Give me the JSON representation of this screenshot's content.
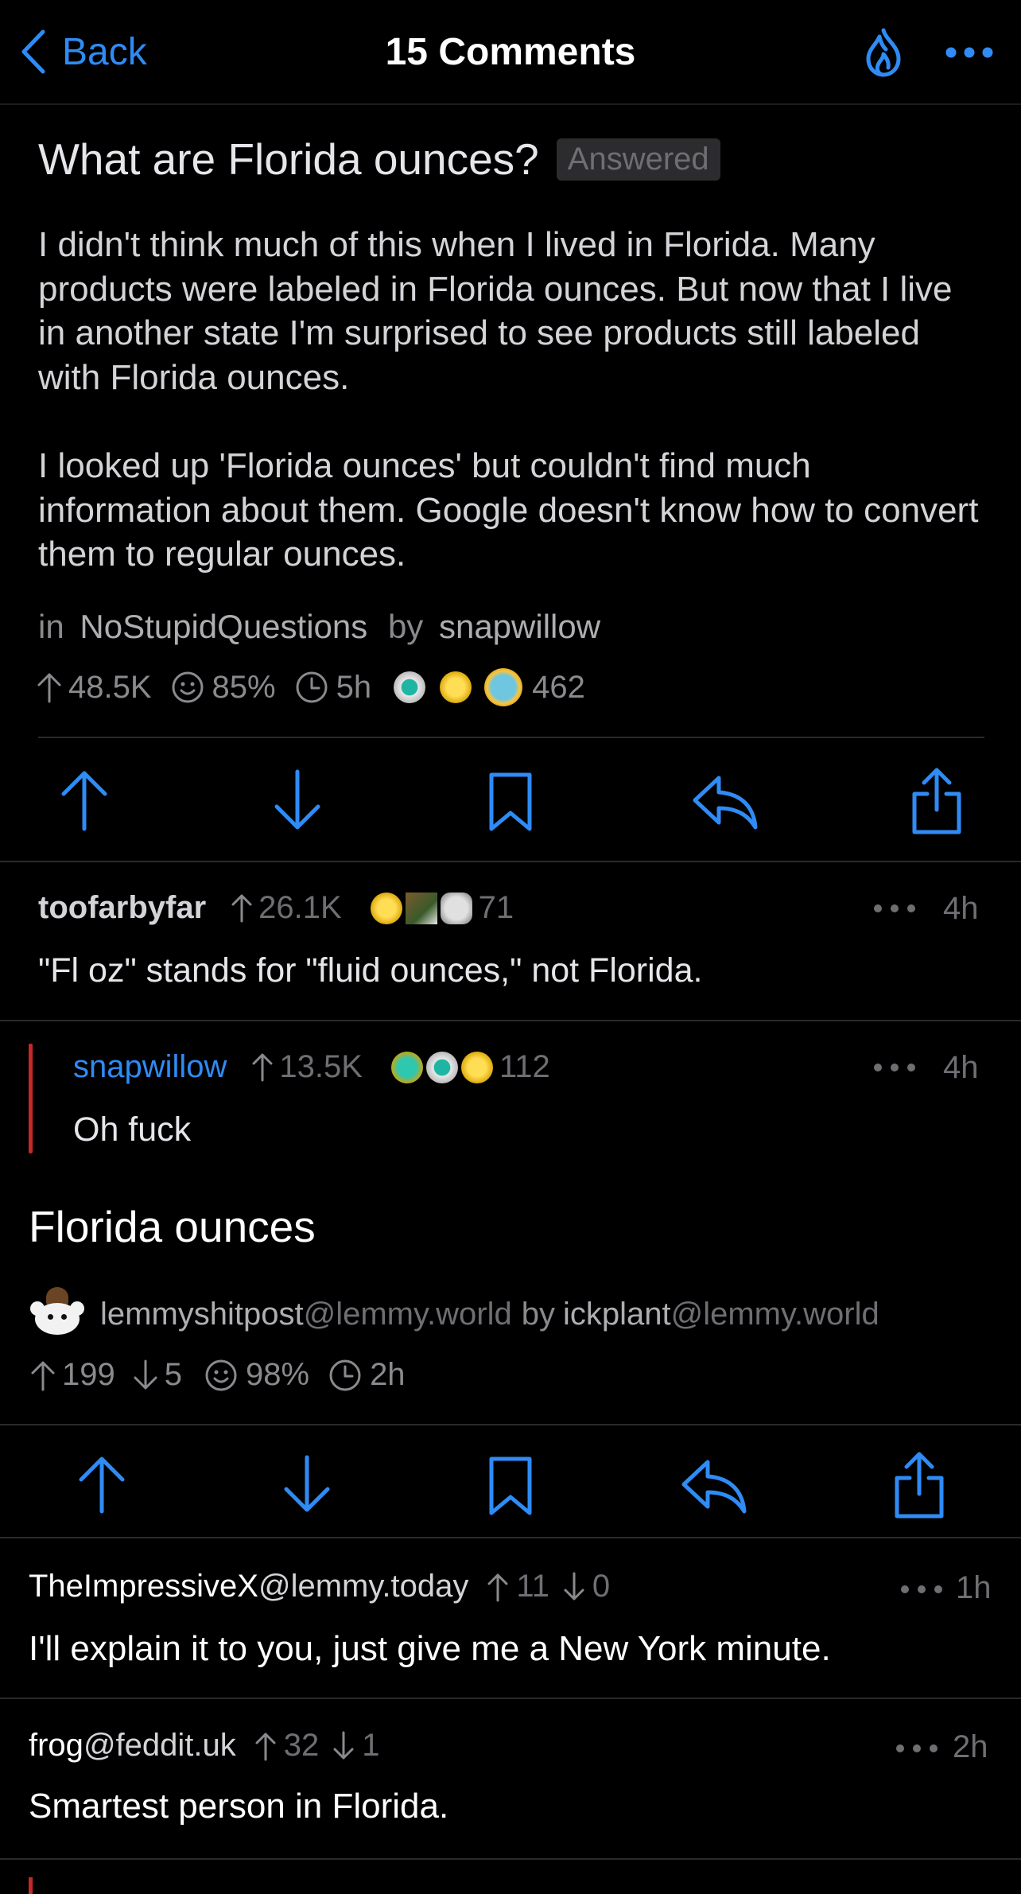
{
  "nav": {
    "back_label": "Back",
    "title": "15 Comments"
  },
  "post1": {
    "title": "What are Florida ounces?",
    "flair": "Answered",
    "body_p1": "I didn't think much of this when I lived in Florida. Many products were labeled in Florida ounces. But now that I live in another state I'm surprised to see products still labeled with Florida ounces.",
    "body_p2": "I looked up 'Florida ounces' but couldn't find much information about them. Google doesn't know how to convert them to regular ounces.",
    "in_label": "in",
    "subreddit": "NoStupidQuestions",
    "by_label": "by",
    "author": "snapwillow",
    "upvotes": "48.5K",
    "ratio": "85%",
    "age": "5h",
    "award_count": "462"
  },
  "comment1": {
    "author": "toofarbyfar",
    "score": "26.1K",
    "award_count": "71",
    "age": "4h",
    "text": "\"Fl oz\" stands for \"fluid ounces,\" not Florida."
  },
  "comment2": {
    "author": "snapwillow",
    "score": "13.5K",
    "award_count": "112",
    "age": "4h",
    "text": "Oh fuck"
  },
  "post2": {
    "title": "Florida ounces",
    "community": "lemmyshitpost",
    "community_instance": "@lemmy.world",
    "by_label": "by",
    "author": "ickplant",
    "author_instance": "@lemmy.world",
    "upvotes": "199",
    "downvotes": "5",
    "ratio": "98%",
    "age": "2h"
  },
  "comment3": {
    "author": "TheImpressiveX",
    "instance": "@lemmy.today",
    "up": "11",
    "down": "0",
    "age": "1h",
    "text": "I'll explain it to you, just give me a New York minute."
  },
  "comment4": {
    "author": "frog",
    "instance": "@feddit.uk",
    "up": "32",
    "down": "1",
    "age": "2h",
    "text": "Smartest person in Florida."
  },
  "colors": {
    "accent": "#2f8bf5",
    "background": "#000000",
    "op_bar": "#c62828",
    "muted": "#8a8a8e"
  }
}
